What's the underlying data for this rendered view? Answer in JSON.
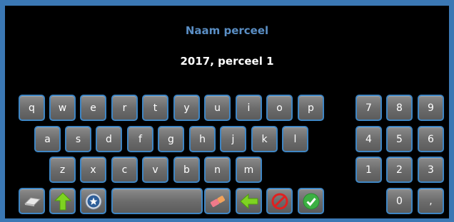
{
  "dialog": {
    "title": "Naam perceel",
    "value": "2017, perceel 1"
  },
  "keyboard": {
    "row1": [
      "q",
      "w",
      "e",
      "r",
      "t",
      "y",
      "u",
      "i",
      "o",
      "p"
    ],
    "row2": [
      "a",
      "s",
      "d",
      "f",
      "g",
      "h",
      "j",
      "k",
      "l"
    ],
    "row3": [
      "z",
      "x",
      "c",
      "v",
      "b",
      "n",
      "m"
    ],
    "numpad": [
      "7",
      "8",
      "9",
      "4",
      "5",
      "6",
      "1",
      "2",
      "3",
      "0",
      ","
    ]
  },
  "icons": {
    "eraser": "eraser-icon",
    "shift": "shift-up-arrow-icon",
    "symbols": "star-circle-icon",
    "clear": "clear-eraser-icon",
    "backspace": "left-arrow-icon",
    "cancel": "cancel-icon",
    "confirm": "confirm-check-icon"
  },
  "colors": {
    "frame": "#3b78b4",
    "title": "#5a8ec4",
    "key_border": "#3f86c4",
    "arrow_green": "#7ed321",
    "cancel_red": "#e02020",
    "confirm_green": "#3cb043"
  }
}
